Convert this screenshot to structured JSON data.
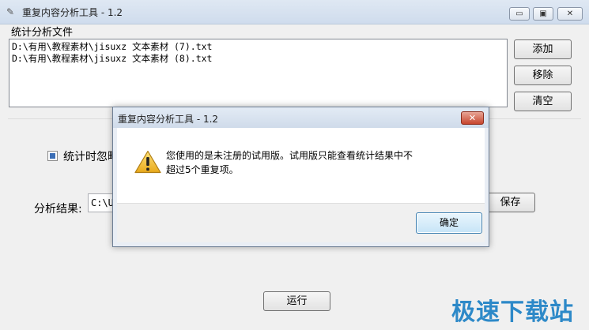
{
  "window": {
    "title": "重复内容分析工具 - 1.2",
    "minimize_label": "▭",
    "restore_label": "▣",
    "close_label": "✕"
  },
  "files_group": {
    "label": "统计分析文件",
    "files": [
      "D:\\有用\\教程素材\\jisuxz 文本素材 (7).txt",
      "D:\\有用\\教程素材\\jisuxz 文本素材 (8).txt"
    ],
    "add_label": "添加",
    "remove_label": "移除",
    "clear_label": "清空"
  },
  "options": {
    "ignore_label": "统计时忽略",
    "ignore_checked": true
  },
  "result": {
    "label": "分析结果:",
    "value": "C:\\U",
    "save_label": "保存"
  },
  "run_label": "运行",
  "dialog": {
    "title": "重复内容分析工具 - 1.2",
    "message": "您使用的是未注册的试用版。试用版只能查看统计结果中不超过5个重复项。",
    "ok_label": "确定",
    "close_label": "✕",
    "icon": "warning-icon"
  },
  "watermark": "极速下载站",
  "colors": {
    "accent": "#2d89c8",
    "dialog_close": "#c7452d",
    "warning": "#f2c230"
  }
}
